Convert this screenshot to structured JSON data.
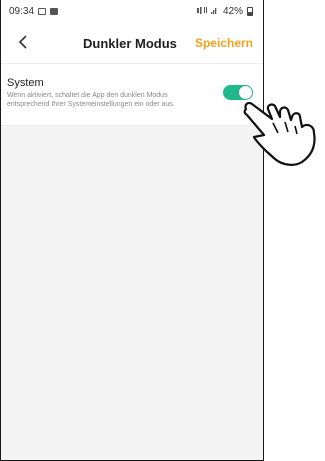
{
  "status_bar": {
    "time": "09:34",
    "battery_percent": "42%",
    "signal_text": "‡ .••"
  },
  "nav": {
    "title": "Dunkler Modus",
    "save_label": "Speichern",
    "back_icon": "chevron-left-icon"
  },
  "settings": [
    {
      "title": "System",
      "description": "Wenn aktiviert, schaltet die App den dunklen Modus entsprechend Ihrer Systemeinstellungen ein oder aus.",
      "enabled": true
    }
  ],
  "colors": {
    "accent": "#f2a11b",
    "toggle_on": "#20b98a",
    "background": "#f4f4f4"
  },
  "overlay": {
    "icon": "pointing-hand-icon"
  }
}
